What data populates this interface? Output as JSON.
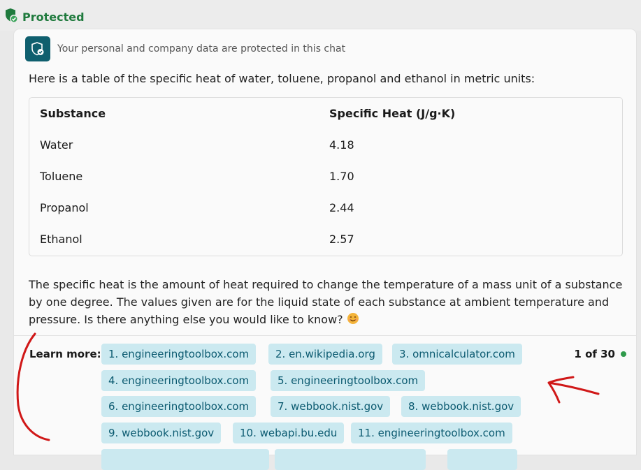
{
  "header": {
    "status_label": "Protected"
  },
  "privacy_notice": "Your personal and company data are protected in this chat",
  "message": {
    "intro": "Here is a table of the specific heat of water, toluene, propanol and ethanol in metric units:",
    "table": {
      "headers": [
        "Substance",
        "Specific Heat (J/g·K)"
      ],
      "rows": [
        [
          "Water",
          "4.18"
        ],
        [
          "Toluene",
          "1.70"
        ],
        [
          "Propanol",
          "2.44"
        ],
        [
          "Ethanol",
          "2.57"
        ]
      ]
    },
    "paragraph": "The specific heat is the amount of heat required to change the temperature of a mass unit of a substance by one degree. The values given are for the liquid state of each substance at ambient temperature and pressure. Is there anything else you would like to know?"
  },
  "learn_more": {
    "label": "Learn more:",
    "links": [
      "1. engineeringtoolbox.com",
      "2. en.wikipedia.org",
      "3. omnicalculator.com",
      "4. engineeringtoolbox.com",
      "5. engineeringtoolbox.com",
      "6. engineeringtoolbox.com",
      "7. webbook.nist.gov",
      "8. webbook.nist.gov",
      "9. webbook.nist.gov",
      "10. webapi.bu.edu",
      "11. engineeringtoolbox.com"
    ],
    "pager": "1 of 30"
  },
  "colors": {
    "protected_green": "#1f7a3d",
    "shield_teal": "#0f5f6e",
    "chip_bg": "#cbe9f0",
    "chip_text": "#0b5a70",
    "annotation_red": "#d01818"
  }
}
